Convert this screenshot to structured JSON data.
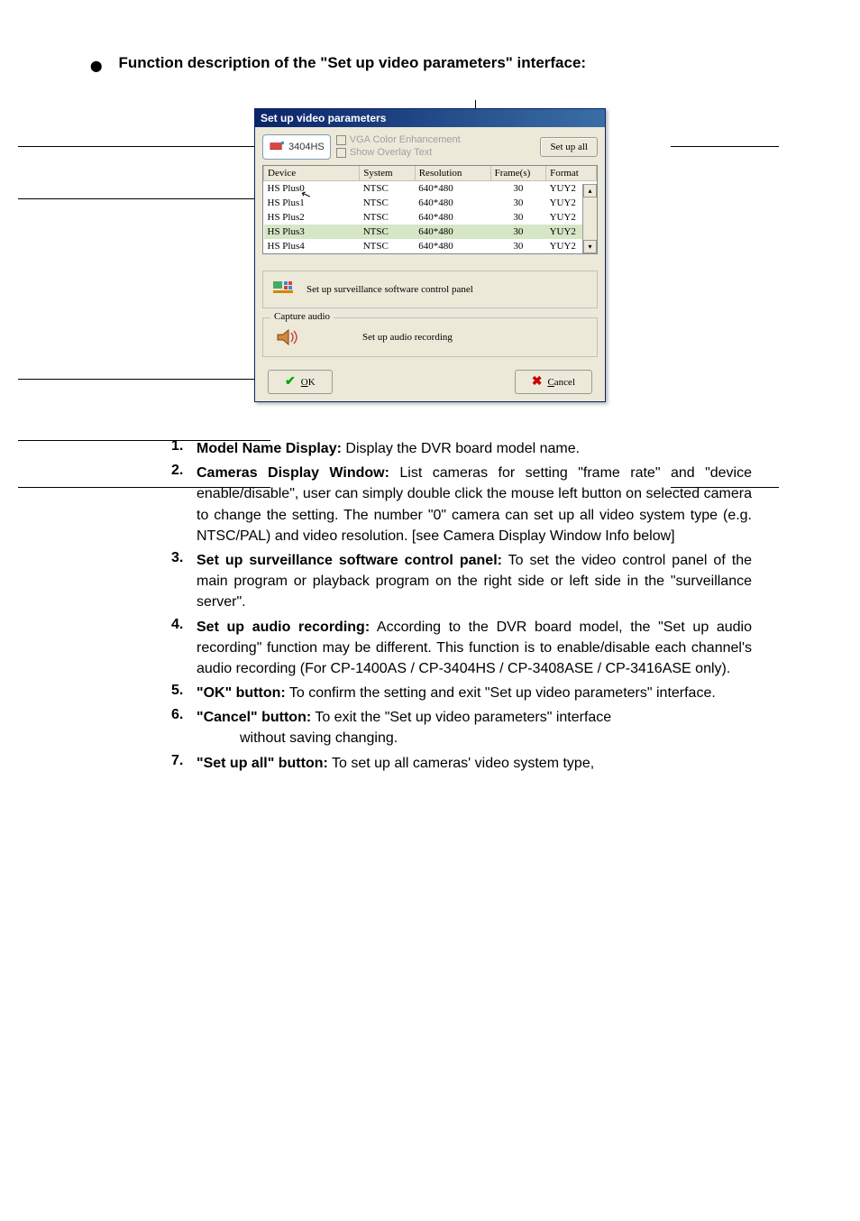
{
  "heading": "Function description of the \"Set up video parameters\" interface:",
  "dialog": {
    "title": "Set up video parameters",
    "model": "3404HS",
    "check1": "VGA Color Enhancement",
    "check2": "Show Overlay Text",
    "setup_all": "Set up all",
    "headers": {
      "device": "Device",
      "system": "System",
      "resolution": "Resolution",
      "frames": "Frame(s)",
      "format": "Format"
    },
    "rows": [
      {
        "device": "HS Plus0",
        "system": "NTSC",
        "resolution": "640*480",
        "frames": "30",
        "format": "YUY2",
        "sel": false
      },
      {
        "device": "HS Plus1",
        "system": "NTSC",
        "resolution": "640*480",
        "frames": "30",
        "format": "YUY2",
        "sel": false
      },
      {
        "device": "HS Plus2",
        "system": "NTSC",
        "resolution": "640*480",
        "frames": "30",
        "format": "YUY2",
        "sel": false
      },
      {
        "device": "HS Plus3",
        "system": "NTSC",
        "resolution": "640*480",
        "frames": "30",
        "format": "YUY2",
        "sel": true
      },
      {
        "device": "HS Plus4",
        "system": "NTSC",
        "resolution": "640*480",
        "frames": "30",
        "format": "YUY2",
        "sel": false
      }
    ],
    "surv_label": "Set up surveillance software control panel",
    "capture_group": "Capture audio",
    "audio_label": "Set up audio recording",
    "ok": "OK",
    "cancel": "Cancel"
  },
  "items": [
    {
      "num": "1.",
      "bold": "Model Name Display:",
      "text": " Display the DVR board model name."
    },
    {
      "num": "2.",
      "bold": "Cameras Display Window:",
      "text": " List cameras for setting \"frame rate\" and \"device enable/disable\", user can simply double click the mouse left button on selected camera to change the setting. The number \"0\" camera can set up all video system type (e.g. NTSC/PAL) and video resolution. [see Camera Display Window Info below]"
    },
    {
      "num": "3.",
      "bold": "Set up surveillance software control panel:",
      "text": " To set the video control panel of the main program or playback program on the right side or left side in the \"surveillance server\"."
    },
    {
      "num": "4.",
      "bold": "Set up audio recording:",
      "text": " According to the DVR board model, the \"Set up audio recording\" function may be different. This function is to enable/disable each channel's audio recording (For CP-1400AS / CP-3404HS / CP-3408ASE / CP-3416ASE only)."
    },
    {
      "num": "5.",
      "bold": "\"OK\" button:",
      "text": " To confirm the setting and exit \"Set up video parameters\" interface."
    },
    {
      "num": "6.",
      "bold": "\"Cancel\" button:",
      "text": " To exit the \"Set up video parameters\" interface",
      "sub": "without saving changing."
    },
    {
      "num": "7.",
      "bold": "\"Set up all\" button:",
      "text": " To set up all cameras' video system type,"
    }
  ]
}
